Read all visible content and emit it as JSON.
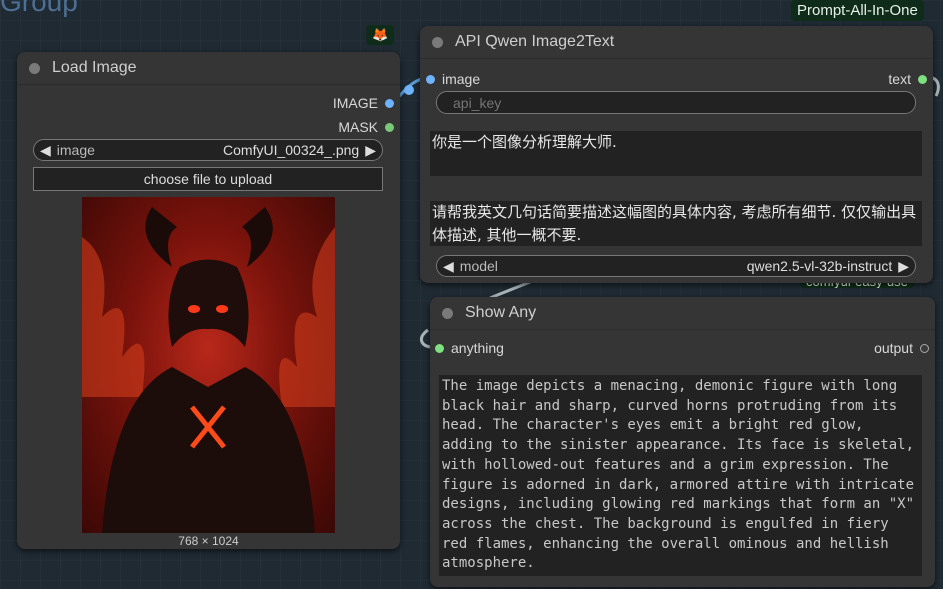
{
  "canvas": {
    "group_title": "Group"
  },
  "tags": {
    "prompt_all_in_one": "Prompt-All-In-One",
    "comfyui_easy_use": "comfyui-easy-use",
    "fox_icon": "🦊"
  },
  "load_image": {
    "title": "Load Image",
    "outputs": {
      "image": "IMAGE",
      "mask": "MASK"
    },
    "image_widget": {
      "label": "image",
      "value": "ComfyUI_00324_.png"
    },
    "upload_button": "choose file to upload",
    "dimensions": "768 × 1024",
    "preview_icon": "demon-portrait-image"
  },
  "qwen": {
    "title": "API Qwen Image2Text",
    "input_label": "image",
    "output_label": "text",
    "api_key_placeholder": "api_key",
    "system_prompt": "你是一个图像分析理解大师.",
    "user_prompt": "请帮我英文几句话简要描述这幅图的具体内容, 考虑所有细节. 仅仅输出具体描述, 其他一概不要.",
    "model_widget": {
      "label": "model",
      "value": "qwen2.5-vl-32b-instruct"
    }
  },
  "show_any": {
    "title": "Show Any",
    "input_label": "anything",
    "output_label": "output",
    "text": "The image depicts a menacing, demonic figure with long black hair and sharp, curved horns protruding from its head. The character's eyes emit a bright red glow, adding to the sinister appearance. Its face is skeletal, with hollowed-out features and a grim expression. The figure is adorned in dark, armored attire with intricate designs, including glowing red markings that form an \"X\" across the chest. The background is engulfed in fiery red flames, enhancing the overall ominous and hellish atmosphere."
  },
  "colors": {
    "image_port": "#6eb3ff",
    "mask_port": "#78c878",
    "any_port": "#7ee07e",
    "link": "#a8b4b8"
  }
}
